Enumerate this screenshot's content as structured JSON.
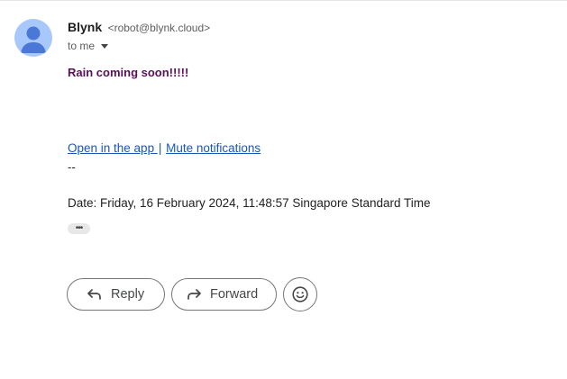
{
  "sender": {
    "name": "Blynk",
    "email": "<robot@blynk.cloud>",
    "to_label": "to me",
    "avatar_color": "#a8c7fa",
    "avatar_icon": "person-icon"
  },
  "message": {
    "headline": "Rain coming soon!!!!!",
    "headline_color": "#5a0f5a",
    "open_app_link": "Open in the app ",
    "link_separator": "|",
    "mute_link": "Mute notifications",
    "signature_dashes": "--",
    "date_text": "Date: Friday, 16 February 2024, 11:48:57 Singapore Standard Time",
    "more_chip": "•••"
  },
  "actions": {
    "reply_label": "Reply",
    "forward_label": "Forward",
    "reply_icon": "reply-icon",
    "forward_icon": "forward-icon",
    "emoji_icon": "emoji-icon"
  }
}
